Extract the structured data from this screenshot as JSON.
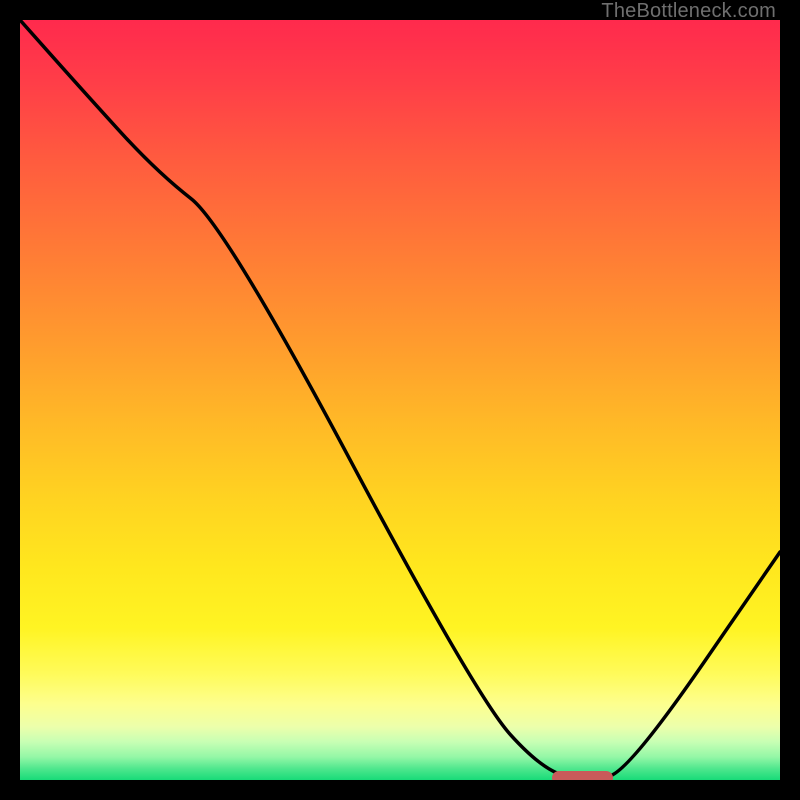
{
  "watermark": "TheBottleneck.com",
  "chart_data": {
    "type": "line",
    "title": "",
    "xlabel": "",
    "ylabel": "",
    "xlim": [
      0,
      100
    ],
    "ylim": [
      0,
      100
    ],
    "x": [
      0,
      8,
      18,
      27,
      60,
      69,
      75,
      80,
      100
    ],
    "values": [
      100,
      91,
      80,
      73,
      11,
      1,
      0,
      1,
      30
    ],
    "marker": {
      "x_start": 70,
      "x_end": 78,
      "y": 0
    },
    "gradient_stops": [
      {
        "pct": 0,
        "color": "#ff2a4d"
      },
      {
        "pct": 50,
        "color": "#ffb300"
      },
      {
        "pct": 85,
        "color": "#fffb5a"
      },
      {
        "pct": 100,
        "color": "#18db78"
      }
    ],
    "legend": [],
    "grid": false
  }
}
